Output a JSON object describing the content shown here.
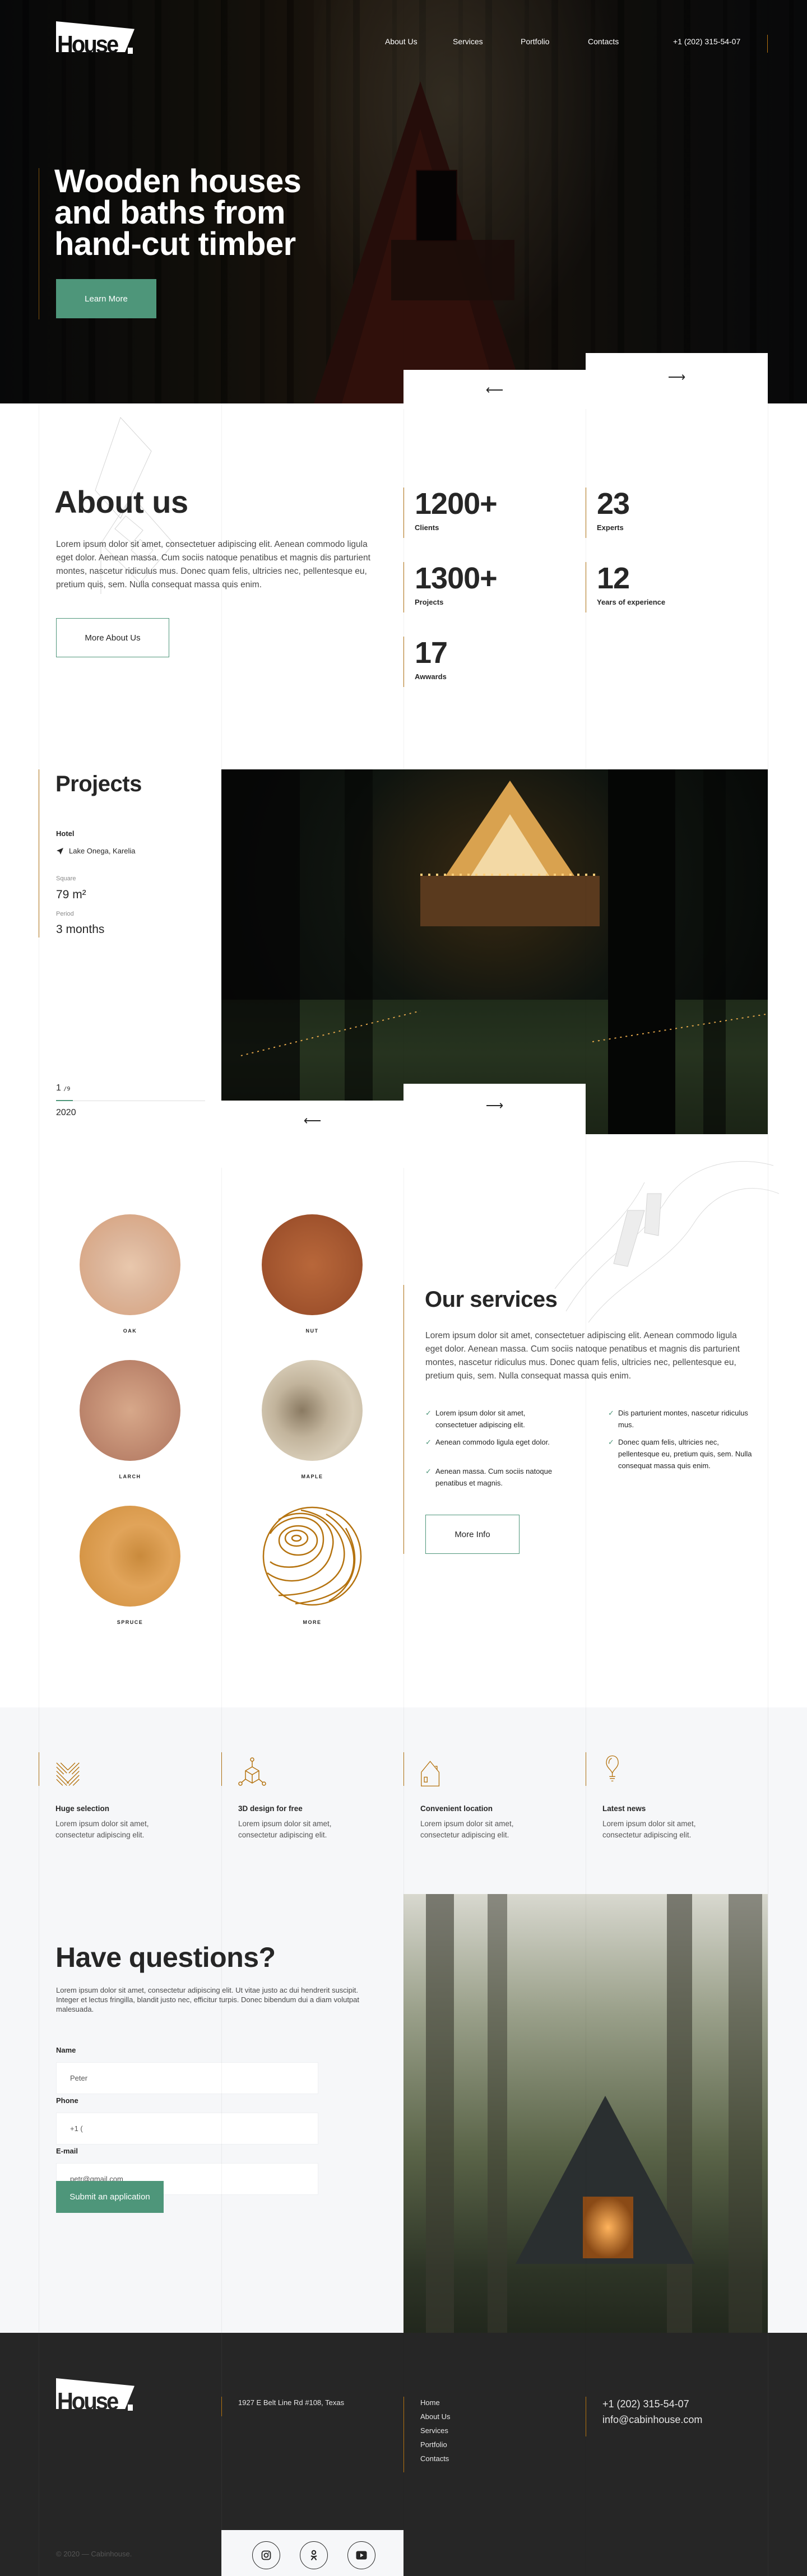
{
  "brand": {
    "logo_text": "House"
  },
  "nav": {
    "items": [
      {
        "label": "About Us"
      },
      {
        "label": "Services"
      },
      {
        "label": "Portfolio"
      },
      {
        "label": "Contacts"
      }
    ],
    "phone": "+1 (202) 315-54-07"
  },
  "hero": {
    "title": "Wooden houses and baths from hand-cut timber",
    "cta_label": "Learn More",
    "prev_icon": "arrow-left-icon",
    "next_icon": "arrow-right-icon"
  },
  "about": {
    "title": "About us",
    "text": "Lorem ipsum dolor sit amet, consectetuer adipiscing elit. Aenean commodo ligula eget dolor. Aenean massa. Cum sociis natoque penatibus et magnis dis parturient montes, nascetur ridiculus mus. Donec quam felis, ultricies nec, pellentesque eu, pretium quis, sem. Nulla consequat massa quis enim.",
    "button_label": "More About Us",
    "stats": [
      {
        "value": "1200+",
        "label": "Clients"
      },
      {
        "value": "23",
        "label": "Experts"
      },
      {
        "value": "1300+",
        "label": "Projects"
      },
      {
        "value": "12",
        "label": "Years of experience"
      },
      {
        "value": "17",
        "label": "Awwards"
      }
    ]
  },
  "projects": {
    "title": "Projects",
    "type": "Hotel",
    "location": "Lake Onega, Karelia",
    "square_label": "Square",
    "square_value": "79 m²",
    "period_label": "Period",
    "period_value": "3 months",
    "slide_current": "1",
    "slide_total": "/9",
    "slide_progress": 0.111,
    "year": "2020"
  },
  "woods": [
    {
      "label": "OAK"
    },
    {
      "label": "NUT"
    },
    {
      "label": "LARCH"
    },
    {
      "label": "MAPLE"
    },
    {
      "label": "SPRUCE"
    },
    {
      "label": "MORE"
    }
  ],
  "services": {
    "title": "Our services",
    "text": "Lorem ipsum dolor sit amet, consectetuer adipiscing elit. Aenean commodo ligula eget dolor. Aenean massa. Cum sociis natoque penatibus et magnis dis parturient montes, nascetur ridiculus mus. Donec quam felis, ultricies nec, pellentesque eu, pretium quis, sem. Nulla consequat massa quis enim.",
    "list_left": [
      "Lorem ipsum dolor sit amet, consectetuer adipiscing elit.",
      "Aenean commodo ligula eget dolor.",
      "Aenean massa. Cum sociis natoque penatibus et magnis."
    ],
    "list_right": [
      "Dis parturient montes, nascetur ridiculus mus.",
      "Donec quam felis, ultricies nec, pellentesque eu, pretium quis, sem. Nulla consequat massa quis enim."
    ],
    "button_label": "More Info"
  },
  "features": [
    {
      "icon": "parquet-icon",
      "title": "Huge selection",
      "text": "Lorem ipsum dolor sit amet, consectetur adipiscing elit."
    },
    {
      "icon": "cube-3d-icon",
      "title": "3D design for free",
      "text": "Lorem ipsum dolor sit amet, consectetur adipiscing elit."
    },
    {
      "icon": "house-icon",
      "title": "Convenient location",
      "text": "Lorem ipsum dolor sit amet, consectetur adipiscing elit."
    },
    {
      "icon": "lightbulb-icon",
      "title": "Latest news",
      "text": "Lorem ipsum dolor sit amet, consectetur adipiscing elit."
    }
  ],
  "contact": {
    "title": "Have questions?",
    "text": "Lorem ipsum dolor sit amet, consectetur adipiscing elit. Ut vitae justo ac dui hendrerit suscipit. Integer et lectus fringilla, blandit justo nec, efficitur turpis. Donec bibendum dui a diam volutpat malesuada.",
    "name_label": "Name",
    "name_value": "Peter",
    "phone_label": "Phone",
    "phone_value": "+1 (",
    "email_label": "E-mail",
    "email_value": "petr@gmail.com",
    "submit_label": "Submit an application"
  },
  "footer": {
    "address": "1927 E Belt Line Rd #108, Texas",
    "links": [
      "Home",
      "About Us",
      "Services",
      "Portfolio",
      "Contacts"
    ],
    "phone": "+1 (202) 315-54-07",
    "email": "info@cabinhouse.com",
    "copyright": "© 2020 — Cabinhouse.",
    "socials": [
      {
        "icon": "instagram-icon"
      },
      {
        "icon": "odnoklassniki-icon"
      },
      {
        "icon": "youtube-icon"
      }
    ]
  },
  "colors": {
    "accent": "#b5730f",
    "primary": "#4e967a",
    "dark": "#262626",
    "light_bg": "#f6f7f9"
  }
}
